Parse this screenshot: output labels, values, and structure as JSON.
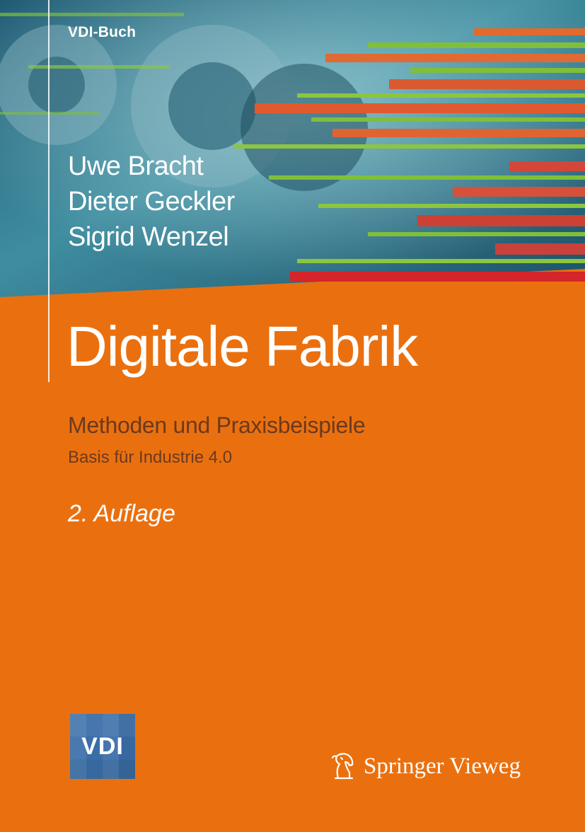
{
  "cover": {
    "series": "VDI-Buch",
    "authors": [
      "Uwe Bracht",
      "Dieter Geckler",
      "Sigrid Wenzel"
    ],
    "title": "Digitale Fabrik",
    "subtitle": "Methoden und Praxisbeispiele",
    "subtitle2": "Basis für Industrie 4.0",
    "edition": "2. Auflage",
    "vdi_logo_text": "VDI",
    "publisher": "Springer Vieweg",
    "logo_icon": "springer-horse-icon"
  },
  "colors": {
    "background": "#ea700f",
    "subtitle_text": "#6b3a1e",
    "vdi_blue": "#3a6ea8",
    "hero_teal": "#2a6d7f"
  }
}
